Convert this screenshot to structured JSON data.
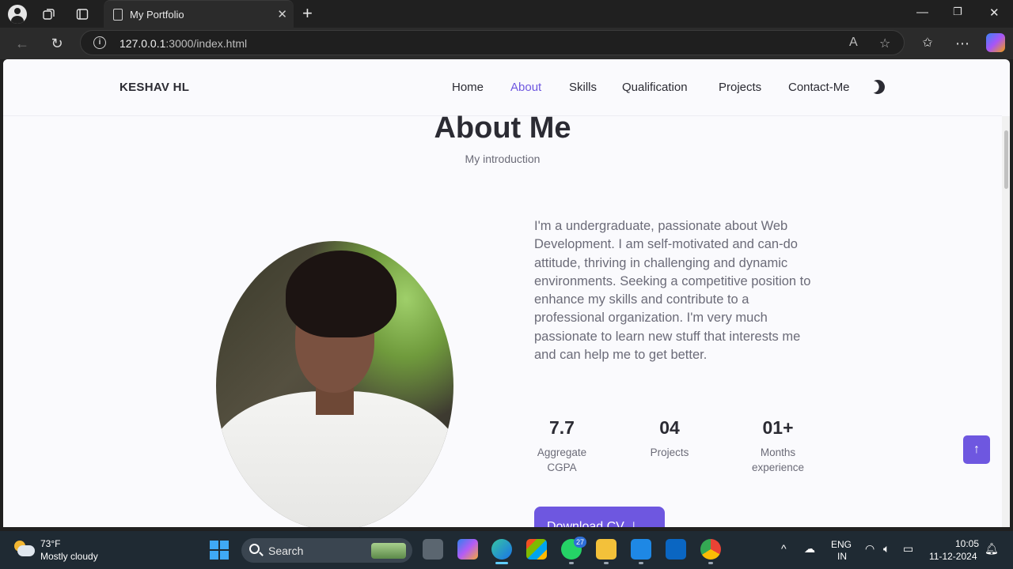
{
  "browser": {
    "tab_title": "My Portfolio",
    "url_host": "127.0.0.1",
    "url_rest": ":3000/index.html"
  },
  "site": {
    "logo": "KESHAV HL",
    "nav": [
      "Home",
      "About",
      "Skills",
      "Qualification",
      "Projects",
      "Contact-Me"
    ],
    "active_nav": "About"
  },
  "about": {
    "title": "About Me",
    "subtitle": "My introduction",
    "description": "I'm a undergraduate, passionate about Web Development. I am self-motivated and can-do attitude, thriving in challenging and dynamic environments. Seeking a competitive position to enhance my skills and contribute to a professional organization. I'm very much passionate to learn new stuff that interests me and can help me to get better.",
    "stats": [
      {
        "value": "7.7",
        "label_line1": "Aggregate",
        "label_line2": "CGPA"
      },
      {
        "value": "04",
        "label_line1": "Projects",
        "label_line2": ""
      },
      {
        "value": "01+",
        "label_line1": "Months",
        "label_line2": "experience"
      }
    ],
    "download_label": "Download CV",
    "accent_color": "#6e57e0"
  },
  "taskbar": {
    "temperature": "73°F",
    "condition": "Mostly cloudy",
    "search_label": "Search",
    "whatsapp_badge": "27",
    "language_line1": "ENG",
    "language_line2": "IN",
    "time": "10:05",
    "date": "11-12-2024"
  }
}
